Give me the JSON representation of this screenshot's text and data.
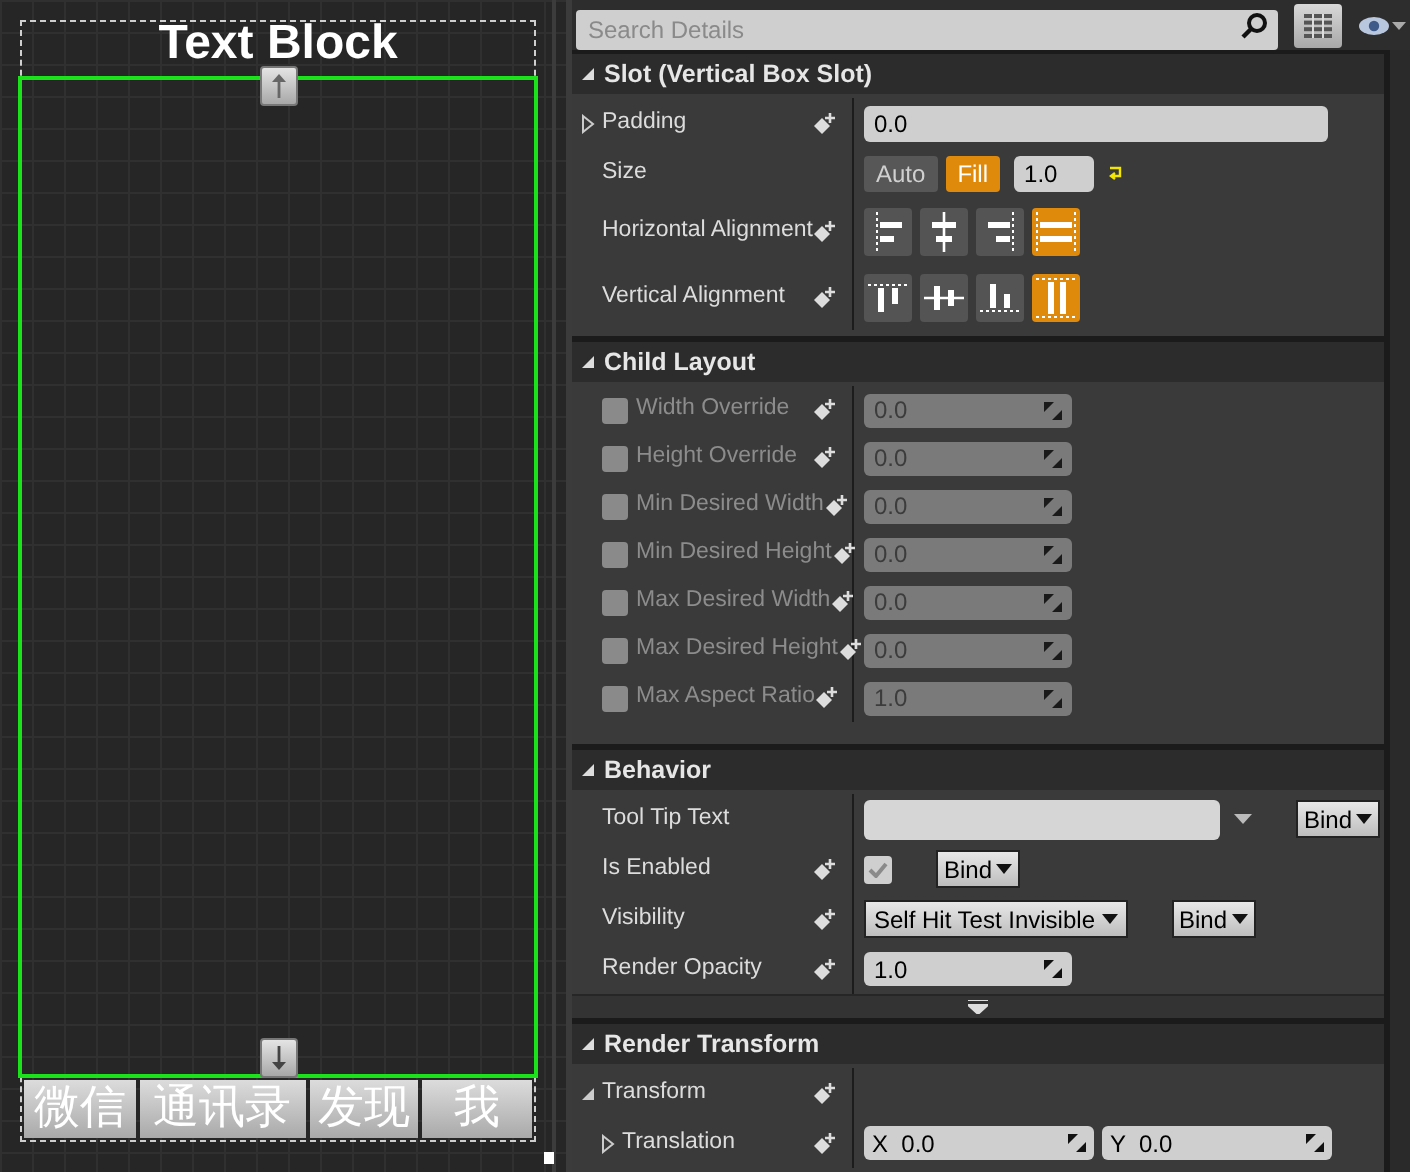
{
  "designer": {
    "title_text": "Text Block",
    "tabs": [
      {
        "label": "微信"
      },
      {
        "label": "通讯录"
      },
      {
        "label": "发现"
      },
      {
        "label": "我"
      }
    ]
  },
  "details": {
    "search": {
      "placeholder": "Search Details"
    },
    "sections": [
      {
        "title": "Slot (Vertical Box Slot)",
        "expanded": true,
        "rows": [
          {
            "kind": "text",
            "label": "Padding",
            "expanded": false,
            "keyable": true,
            "value": "0.0"
          },
          {
            "kind": "size",
            "label": "Size",
            "keyable": false,
            "options": [
              {
                "label": "Auto",
                "selected": false
              },
              {
                "label": "Fill",
                "selected": true
              }
            ],
            "value": "1.0"
          },
          {
            "kind": "align",
            "label": "Horizontal Alignment",
            "keyable": true,
            "options": [
              {
                "kind": "left",
                "selected": false
              },
              {
                "kind": "hcenter",
                "selected": false
              },
              {
                "kind": "right",
                "selected": false
              },
              {
                "kind": "hfill",
                "selected": true
              }
            ]
          },
          {
            "kind": "align",
            "label": "Vertical Alignment",
            "keyable": true,
            "options": [
              {
                "kind": "top",
                "selected": false
              },
              {
                "kind": "vcenter",
                "selected": false
              },
              {
                "kind": "bottom",
                "selected": false
              },
              {
                "kind": "vfill",
                "selected": true
              }
            ]
          }
        ]
      },
      {
        "title": "Child Layout",
        "expanded": true,
        "rows": [
          {
            "kind": "override",
            "label": "Width Override",
            "checked": false,
            "disabled": true,
            "keyable": true,
            "value": "0.0"
          },
          {
            "kind": "override",
            "label": "Height Override",
            "checked": false,
            "disabled": true,
            "keyable": true,
            "value": "0.0"
          },
          {
            "kind": "override",
            "label": "Min Desired Width",
            "checked": false,
            "disabled": true,
            "keyable": true,
            "value": "0.0"
          },
          {
            "kind": "override",
            "label": "Min Desired Height",
            "checked": false,
            "disabled": true,
            "keyable": true,
            "value": "0.0"
          },
          {
            "kind": "override",
            "label": "Max Desired Width",
            "checked": false,
            "disabled": true,
            "keyable": true,
            "value": "0.0"
          },
          {
            "kind": "override",
            "label": "Max Desired Height",
            "checked": false,
            "disabled": true,
            "keyable": true,
            "value": "0.0"
          },
          {
            "kind": "override",
            "label": "Max Aspect Ratio",
            "checked": false,
            "disabled": true,
            "keyable": true,
            "value": "1.0"
          }
        ]
      },
      {
        "title": "Behavior",
        "expanded": true,
        "has_advanced": true,
        "rows": [
          {
            "kind": "tooltip",
            "label": "Tool Tip Text",
            "keyable": false,
            "bind": "Bind"
          },
          {
            "kind": "checkbox",
            "label": "Is Enabled",
            "keyable": true,
            "checked": true,
            "bind": "Bind"
          },
          {
            "kind": "combo",
            "label": "Visibility",
            "keyable": true,
            "value": "Self Hit Test Invisible",
            "bind": "Bind"
          },
          {
            "kind": "spin",
            "label": "Render Opacity",
            "keyable": true,
            "value": "1.0"
          }
        ]
      },
      {
        "title": "Render Transform",
        "expanded": true,
        "rows": [
          {
            "kind": "group",
            "label": "Transform",
            "expanded": true,
            "keyable": true,
            "children": [
              {
                "kind": "vector",
                "label": "Translation",
                "expanded": false,
                "keyable": true,
                "fields": [
                  {
                    "axis": "X",
                    "value": "0.0"
                  },
                  {
                    "axis": "Y",
                    "value": "0.0"
                  }
                ]
              }
            ]
          }
        ]
      }
    ]
  }
}
